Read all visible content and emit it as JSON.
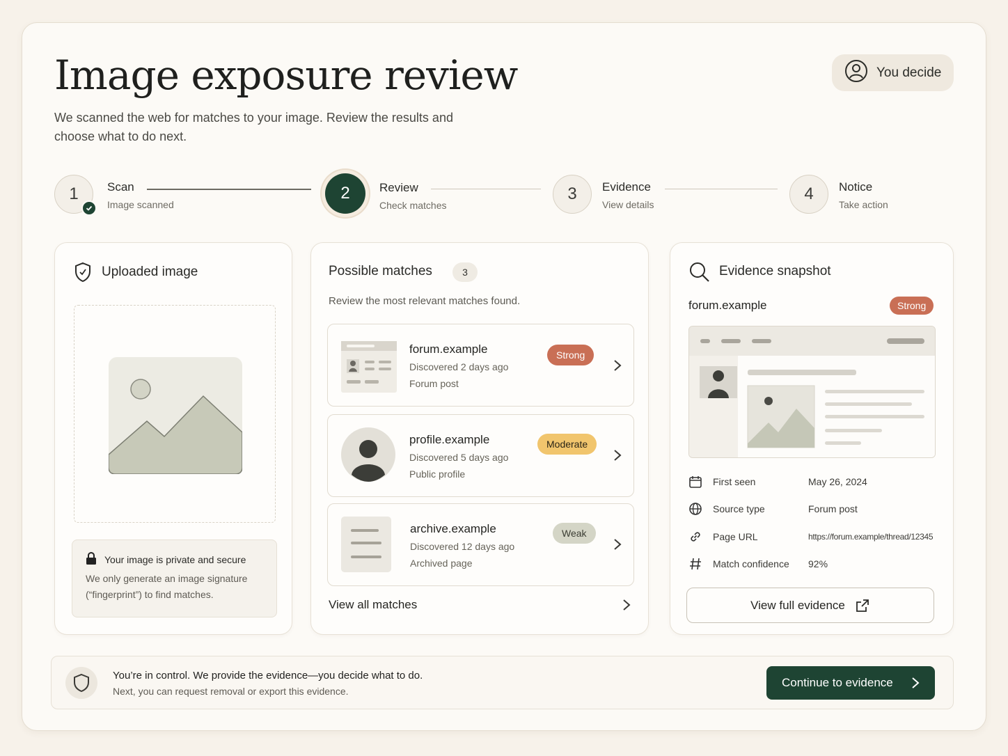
{
  "header": {
    "title": "Image exposure review",
    "subtitle": "We scanned the web for matches to your image. Review the results and choose what to do next.",
    "you_decide": "You decide"
  },
  "steps": [
    {
      "number": "1",
      "label": "Scan",
      "sub": "Image scanned",
      "state": "done"
    },
    {
      "number": "2",
      "label": "Review",
      "sub": "Check matches",
      "state": "active"
    },
    {
      "number": "3",
      "label": "Evidence",
      "sub": "View details",
      "state": "pending"
    },
    {
      "number": "4",
      "label": "Notice",
      "sub": "Take action",
      "state": "pending"
    }
  ],
  "uploaded": {
    "title": "Uploaded image",
    "secure_title": "Your image is private and secure",
    "secure_body": "We only generate an image signature (“fingerprint”) to find matches."
  },
  "matches": {
    "title": "Possible matches",
    "count": "3",
    "subtitle": "Review the most relevant matches found.",
    "items": [
      {
        "name": "forum.example",
        "discovered": "Discovered 2 days ago",
        "type": "Forum post",
        "strength": "Strong"
      },
      {
        "name": "profile.example",
        "discovered": "Discovered 5 days ago",
        "type": "Public profile",
        "strength": "Moderate"
      },
      {
        "name": "archive.example",
        "discovered": "Discovered 12 days ago",
        "type": "Archived page",
        "strength": "Weak"
      }
    ],
    "view_all": "View all matches"
  },
  "evidence": {
    "title": "Evidence snapshot",
    "domain": "forum.example",
    "strength": "Strong",
    "rows": [
      {
        "label": "First seen",
        "value": "May 26, 2024",
        "icon": "calendar-icon"
      },
      {
        "label": "Source type",
        "value": "Forum post",
        "icon": "globe-icon"
      },
      {
        "label": "Page URL",
        "value": "https://forum.example/thread/12345",
        "icon": "link-icon"
      },
      {
        "label": "Match confidence",
        "value": "92%",
        "icon": "hash-icon"
      }
    ],
    "button": "View full evidence"
  },
  "footer": {
    "title": "You’re in control. We provide the evidence—you decide what to do.",
    "subtitle": "Next, you can request removal or export this evidence.",
    "continue": "Continue to evidence"
  },
  "colors": {
    "accent": "#1e4433",
    "strong": "#c96f55",
    "moderate": "#f1c56d",
    "weak": "#d4d5c6",
    "background": "#f7f2ea"
  }
}
